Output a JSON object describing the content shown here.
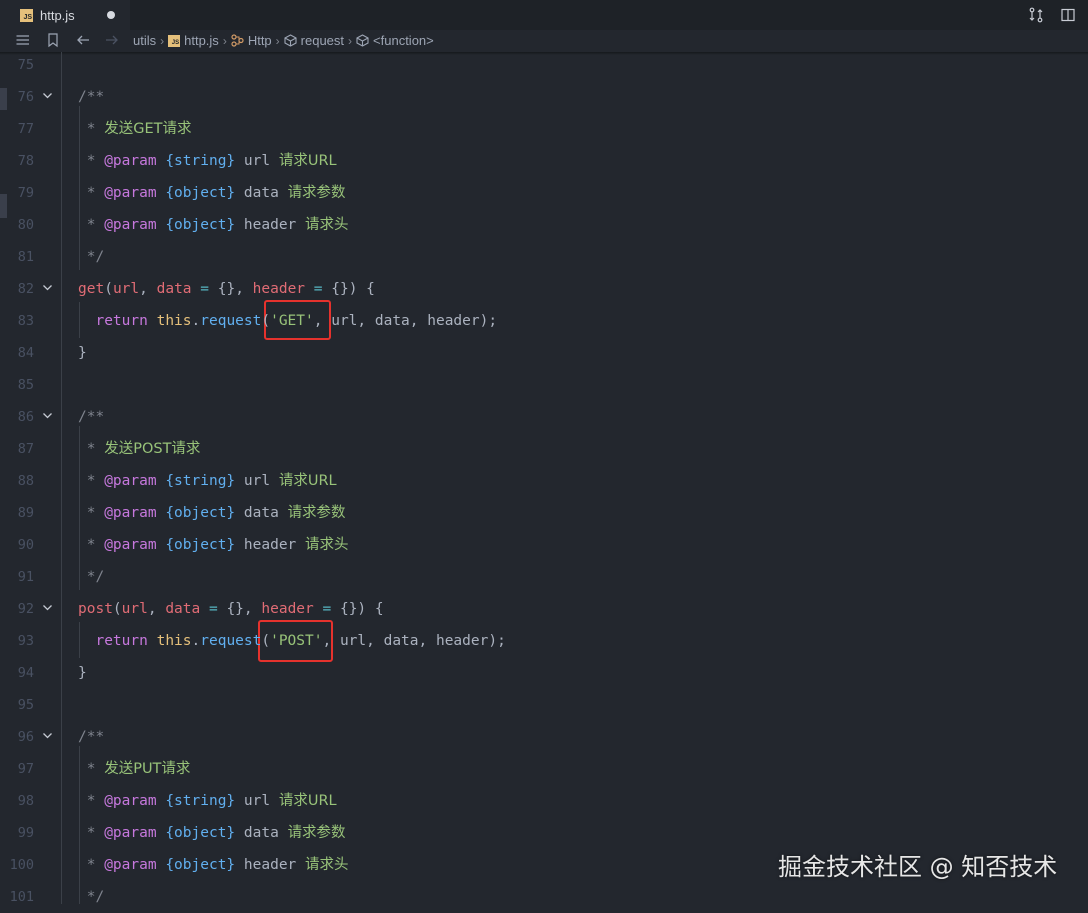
{
  "tab": {
    "title": "http.js",
    "badge": "JS"
  },
  "breadcrumb": {
    "items": [
      {
        "label": "utils",
        "icon": "none"
      },
      {
        "label": "http.js",
        "icon": "js-file-icon"
      },
      {
        "label": "Http",
        "icon": "class-icon"
      },
      {
        "label": "request",
        "icon": "method-icon"
      },
      {
        "label": "<function>",
        "icon": "method-icon"
      }
    ]
  },
  "editor": {
    "lines": [
      {
        "n": "75",
        "fold": false,
        "tokens": []
      },
      {
        "n": "76",
        "fold": true,
        "tokens": [
          [
            "c-comment",
            "/**"
          ]
        ]
      },
      {
        "n": "77",
        "fold": false,
        "tokens": [
          [
            "c-comment",
            " * "
          ],
          [
            "c-cjk",
            "发送GET请求"
          ]
        ]
      },
      {
        "n": "78",
        "fold": false,
        "tokens": [
          [
            "c-comment",
            " * "
          ],
          [
            "c-tag",
            "@param"
          ],
          [
            "c-plain",
            " "
          ],
          [
            "c-type",
            "{string}"
          ],
          [
            "c-plain",
            " url "
          ],
          [
            "c-cjk",
            "请求URL"
          ]
        ]
      },
      {
        "n": "79",
        "fold": false,
        "tokens": [
          [
            "c-comment",
            " * "
          ],
          [
            "c-tag",
            "@param"
          ],
          [
            "c-plain",
            " "
          ],
          [
            "c-type",
            "{object}"
          ],
          [
            "c-plain",
            " data "
          ],
          [
            "c-cjk",
            "请求参数"
          ]
        ]
      },
      {
        "n": "80",
        "fold": false,
        "tokens": [
          [
            "c-comment",
            " * "
          ],
          [
            "c-tag",
            "@param"
          ],
          [
            "c-plain",
            " "
          ],
          [
            "c-type",
            "{object}"
          ],
          [
            "c-plain",
            " header "
          ],
          [
            "c-cjk",
            "请求头"
          ]
        ]
      },
      {
        "n": "81",
        "fold": false,
        "tokens": [
          [
            "c-comment",
            " */"
          ]
        ]
      },
      {
        "n": "82",
        "fold": true,
        "tokens": [
          [
            "c-fn",
            "get"
          ],
          [
            "c-punct",
            "("
          ],
          [
            "c-param",
            "url"
          ],
          [
            "c-punct",
            ", "
          ],
          [
            "c-param",
            "data"
          ],
          [
            "c-punct",
            " "
          ],
          [
            "c-cyan",
            "="
          ],
          [
            "c-punct",
            " {}, "
          ],
          [
            "c-param",
            "header"
          ],
          [
            "c-punct",
            " "
          ],
          [
            "c-cyan",
            "="
          ],
          [
            "c-punct",
            " {}) {"
          ]
        ]
      },
      {
        "n": "83",
        "fold": false,
        "tokens": [
          [
            "c-plain",
            "  "
          ],
          [
            "c-ret",
            "return"
          ],
          [
            "c-plain",
            " "
          ],
          [
            "c-this",
            "this"
          ],
          [
            "c-punct",
            "."
          ],
          [
            "c-method",
            "request"
          ],
          [
            "c-punct",
            "("
          ],
          [
            "c-str",
            "'GET'"
          ],
          [
            "c-punct",
            ", url, data, header);"
          ]
        ]
      },
      {
        "n": "84",
        "fold": false,
        "tokens": [
          [
            "c-punct",
            "}"
          ]
        ]
      },
      {
        "n": "85",
        "fold": false,
        "tokens": []
      },
      {
        "n": "86",
        "fold": true,
        "tokens": [
          [
            "c-comment",
            "/**"
          ]
        ]
      },
      {
        "n": "87",
        "fold": false,
        "tokens": [
          [
            "c-comment",
            " * "
          ],
          [
            "c-cjk",
            "发送POST请求"
          ]
        ]
      },
      {
        "n": "88",
        "fold": false,
        "tokens": [
          [
            "c-comment",
            " * "
          ],
          [
            "c-tag",
            "@param"
          ],
          [
            "c-plain",
            " "
          ],
          [
            "c-type",
            "{string}"
          ],
          [
            "c-plain",
            " url "
          ],
          [
            "c-cjk",
            "请求URL"
          ]
        ]
      },
      {
        "n": "89",
        "fold": false,
        "tokens": [
          [
            "c-comment",
            " * "
          ],
          [
            "c-tag",
            "@param"
          ],
          [
            "c-plain",
            " "
          ],
          [
            "c-type",
            "{object}"
          ],
          [
            "c-plain",
            " data "
          ],
          [
            "c-cjk",
            "请求参数"
          ]
        ]
      },
      {
        "n": "90",
        "fold": false,
        "tokens": [
          [
            "c-comment",
            " * "
          ],
          [
            "c-tag",
            "@param"
          ],
          [
            "c-plain",
            " "
          ],
          [
            "c-type",
            "{object}"
          ],
          [
            "c-plain",
            " header "
          ],
          [
            "c-cjk",
            "请求头"
          ]
        ]
      },
      {
        "n": "91",
        "fold": false,
        "tokens": [
          [
            "c-comment",
            " */"
          ]
        ]
      },
      {
        "n": "92",
        "fold": true,
        "tokens": [
          [
            "c-fn",
            "post"
          ],
          [
            "c-punct",
            "("
          ],
          [
            "c-param",
            "url"
          ],
          [
            "c-punct",
            ", "
          ],
          [
            "c-param",
            "data"
          ],
          [
            "c-punct",
            " "
          ],
          [
            "c-cyan",
            "="
          ],
          [
            "c-punct",
            " {}, "
          ],
          [
            "c-param",
            "header"
          ],
          [
            "c-punct",
            " "
          ],
          [
            "c-cyan",
            "="
          ],
          [
            "c-punct",
            " {}) {"
          ]
        ]
      },
      {
        "n": "93",
        "fold": false,
        "tokens": [
          [
            "c-plain",
            "  "
          ],
          [
            "c-ret",
            "return"
          ],
          [
            "c-plain",
            " "
          ],
          [
            "c-this",
            "this"
          ],
          [
            "c-punct",
            "."
          ],
          [
            "c-method",
            "request"
          ],
          [
            "c-punct",
            "("
          ],
          [
            "c-str",
            "'POST'"
          ],
          [
            "c-punct",
            ", url, data, header);"
          ]
        ]
      },
      {
        "n": "94",
        "fold": false,
        "tokens": [
          [
            "c-punct",
            "}"
          ]
        ]
      },
      {
        "n": "95",
        "fold": false,
        "tokens": []
      },
      {
        "n": "96",
        "fold": true,
        "tokens": [
          [
            "c-comment",
            "/**"
          ]
        ]
      },
      {
        "n": "97",
        "fold": false,
        "tokens": [
          [
            "c-comment",
            " * "
          ],
          [
            "c-cjk",
            "发送PUT请求"
          ]
        ]
      },
      {
        "n": "98",
        "fold": false,
        "tokens": [
          [
            "c-comment",
            " * "
          ],
          [
            "c-tag",
            "@param"
          ],
          [
            "c-plain",
            " "
          ],
          [
            "c-type",
            "{string}"
          ],
          [
            "c-plain",
            " url "
          ],
          [
            "c-cjk",
            "请求URL"
          ]
        ]
      },
      {
        "n": "99",
        "fold": false,
        "tokens": [
          [
            "c-comment",
            " * "
          ],
          [
            "c-tag",
            "@param"
          ],
          [
            "c-plain",
            " "
          ],
          [
            "c-type",
            "{object}"
          ],
          [
            "c-plain",
            " data "
          ],
          [
            "c-cjk",
            "请求参数"
          ]
        ]
      },
      {
        "n": "100",
        "fold": false,
        "tokens": [
          [
            "c-comment",
            " * "
          ],
          [
            "c-tag",
            "@param"
          ],
          [
            "c-plain",
            " "
          ],
          [
            "c-type",
            "{object}"
          ],
          [
            "c-plain",
            " header "
          ],
          [
            "c-cjk",
            "请求头"
          ]
        ]
      },
      {
        "n": "101",
        "fold": false,
        "tokens": [
          [
            "c-comment",
            " */"
          ]
        ]
      }
    ]
  },
  "watermark": "掘金技术社区 @ 知否技术",
  "colors": {
    "highlight_box": "#e5322d",
    "background": "#23272e"
  }
}
